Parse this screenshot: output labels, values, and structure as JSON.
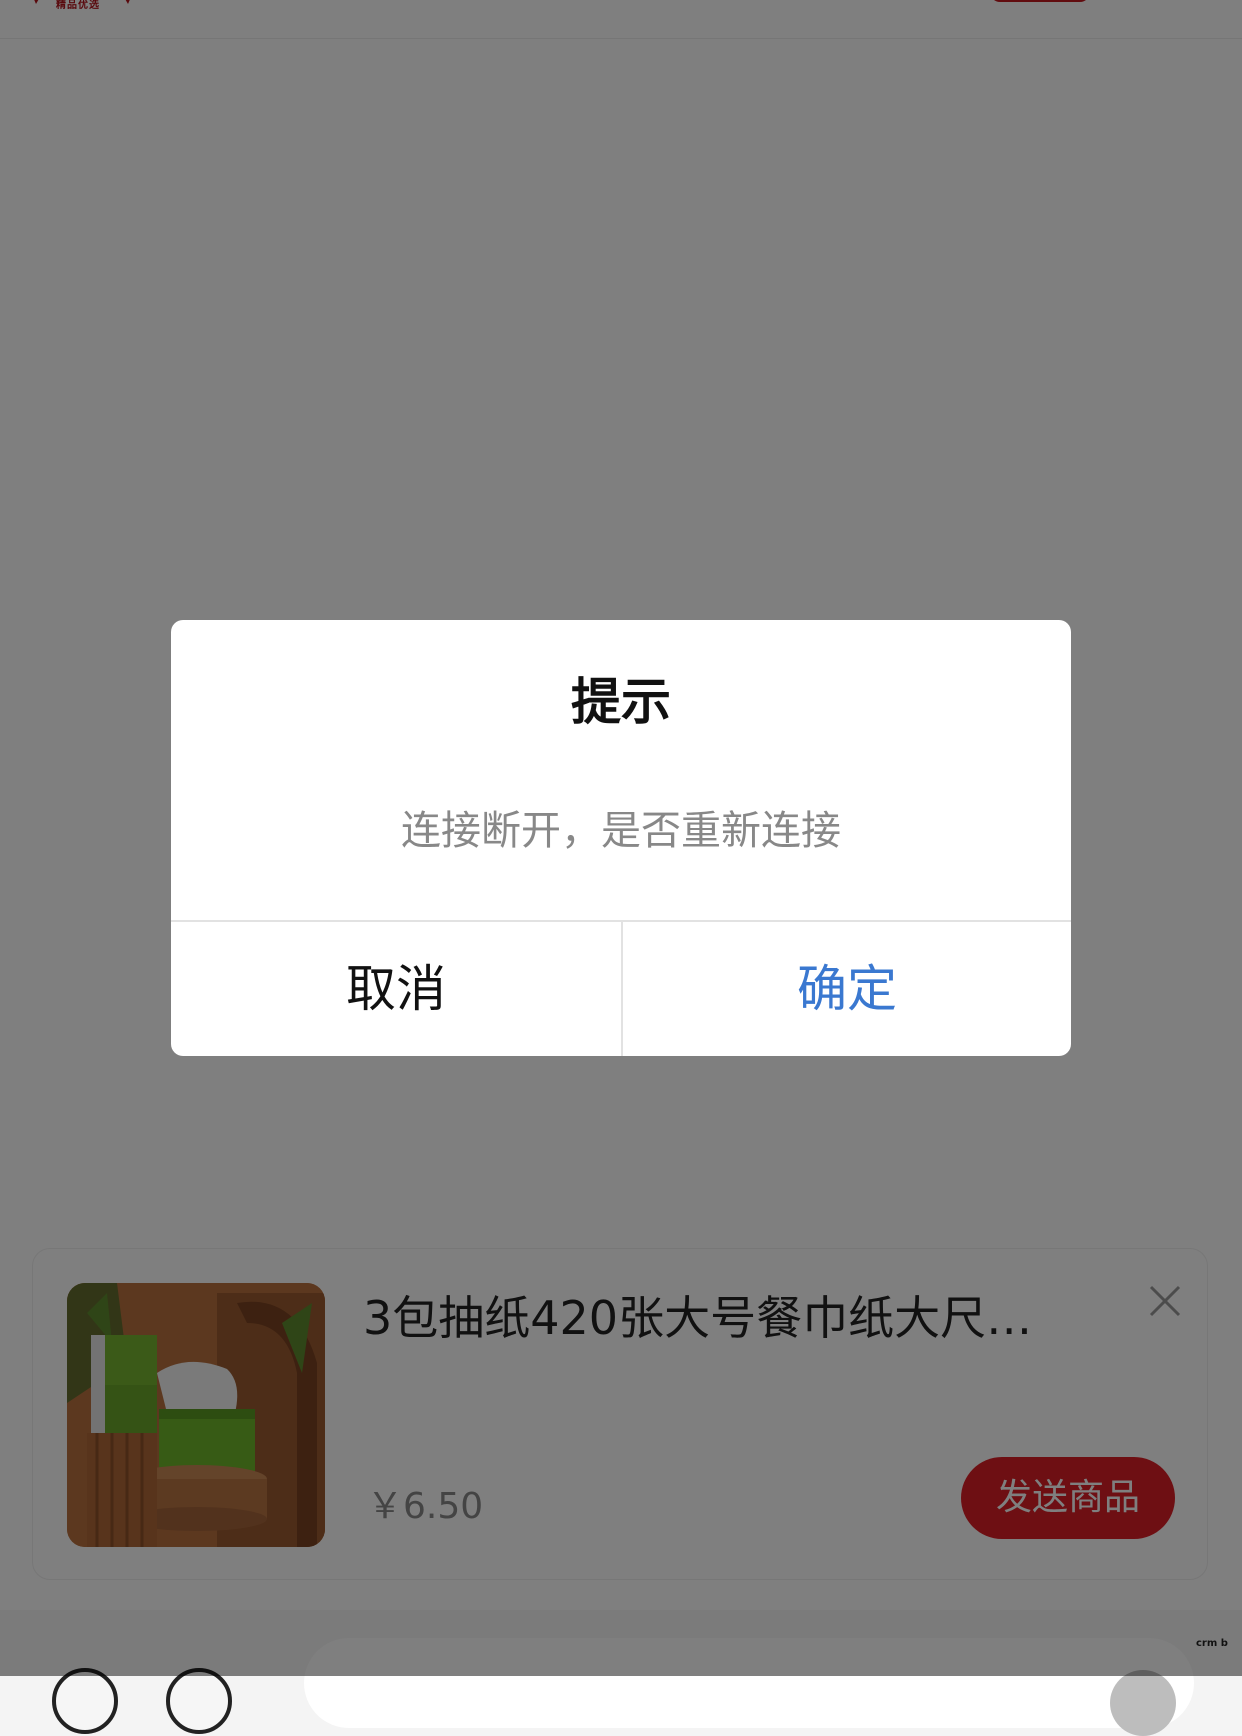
{
  "header": {
    "logo_text": "精品优选"
  },
  "product": {
    "title": "3包抽纸420张大号餐巾纸大尺…",
    "price": "￥6.50",
    "send_label": "发送商品",
    "image_icon": "tissue-box-image"
  },
  "dialog": {
    "title": "提示",
    "message": "连接断开，是否重新连接",
    "cancel_label": "取消",
    "confirm_label": "确定"
  },
  "watermark": "crm b",
  "colors": {
    "brand_red": "#dd1f26",
    "confirm_blue": "#3a78d0",
    "overlay": "rgba(0,0,0,0.5)"
  }
}
